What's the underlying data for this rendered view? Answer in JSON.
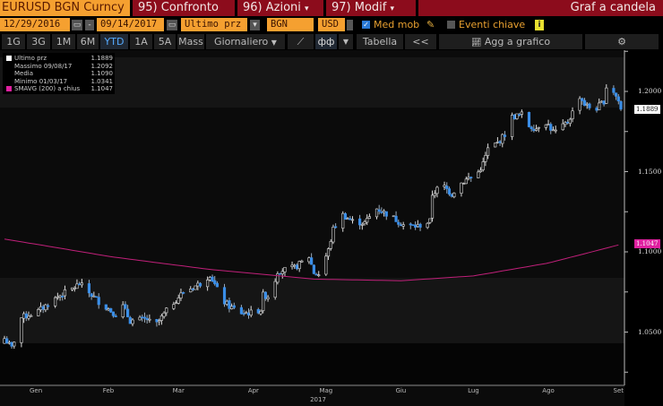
{
  "header": {
    "ticker": "EURUSD BGN Curncy",
    "compare_button": "95) Confronto",
    "actions_button": "96) Azioni",
    "edit_button": "97) Modif",
    "chart_type_title": "Graf a candela"
  },
  "controls": {
    "start_date": "12/29/2016",
    "date_separator": "-",
    "end_date": "09/14/2017",
    "field": "Ultimo prz",
    "source": "BGN",
    "currency": "USD",
    "moving_avg_label": "Med mob",
    "moving_avg_checked": true,
    "events_label": "Eventi chiave",
    "events_checked": false,
    "info_icon": "i"
  },
  "toolbar": {
    "periods": [
      "1G",
      "3G",
      "1M",
      "6M",
      "YTD",
      "1A",
      "5A",
      "Mass"
    ],
    "selected_period": "YTD",
    "frequency": "Giornaliero",
    "table_button": "Tabella",
    "collapse_button": "<<",
    "add_to_chart_button": "Agg a grafico"
  },
  "legend": [
    {
      "label": "Ultimo prz",
      "value": "1.1889",
      "color": "#ffffff"
    },
    {
      "label": "Massimo 09/08/17",
      "value": "1.2092",
      "color": ""
    },
    {
      "label": "Media",
      "value": "1.1090",
      "color": ""
    },
    {
      "label": "Minimo 01/03/17",
      "value": "1.0341",
      "color": ""
    },
    {
      "label": "SMAVG (200) a chius",
      "value": "1.1047",
      "color": "#e020a0"
    }
  ],
  "chart_data": {
    "type": "candlestick",
    "title": "Graf a candela",
    "year_label": "2017",
    "x_ticks": [
      "Gen",
      "Feb",
      "Mar",
      "Apr",
      "Mag",
      "Giu",
      "Lug",
      "Ago",
      "Set"
    ],
    "y_ticks": [
      "1.2000",
      "1.1500",
      "1.1000",
      "1.0500"
    ],
    "y_tick_values": [
      1.2,
      1.15,
      1.1,
      1.05
    ],
    "ylim": [
      1.018,
      1.225
    ],
    "last_price_tag": "1.1889",
    "sma_tag": "1.1047",
    "close_keypoints": [
      [
        "01/02",
        1.046
      ],
      [
        "01/05",
        1.04
      ],
      [
        "01/09",
        1.059
      ],
      [
        "01/16",
        1.063
      ],
      [
        "01/24",
        1.072
      ],
      [
        "01/30",
        1.077
      ],
      [
        "02/02",
        1.08
      ],
      [
        "02/10",
        1.069
      ],
      [
        "02/17",
        1.061
      ],
      [
        "02/20",
        1.066
      ],
      [
        "02/23",
        1.057
      ],
      [
        "03/02",
        1.058
      ],
      [
        "03/05",
        1.053
      ],
      [
        "03/12",
        1.067
      ],
      [
        "03/17",
        1.075
      ],
      [
        "03/25",
        1.081
      ],
      [
        "03/28",
        1.086
      ],
      [
        "04/02",
        1.07
      ],
      [
        "04/05",
        1.066
      ],
      [
        "04/10",
        1.062
      ],
      [
        "04/14",
        1.062
      ],
      [
        "04/18",
        1.064
      ],
      [
        "04/19",
        1.073
      ],
      [
        "04/22",
        1.072
      ],
      [
        "04/25",
        1.088
      ],
      [
        "05/02",
        1.09
      ],
      [
        "05/08",
        1.097
      ],
      [
        "05/10",
        1.087
      ],
      [
        "05/12",
        1.086
      ],
      [
        "05/16",
        1.101
      ],
      [
        "05/18",
        1.114
      ],
      [
        "05/22",
        1.123
      ],
      [
        "05/26",
        1.119
      ],
      [
        "05/31",
        1.118
      ],
      [
        "06/05",
        1.127
      ],
      [
        "06/10",
        1.123
      ],
      [
        "06/12",
        1.121
      ],
      [
        "06/17",
        1.116
      ],
      [
        "06/22",
        1.116
      ],
      [
        "06/27",
        1.119
      ],
      [
        "06/28",
        1.136
      ],
      [
        "07/02",
        1.142
      ],
      [
        "07/06",
        1.136
      ],
      [
        "07/09",
        1.142
      ],
      [
        "07/13",
        1.146
      ],
      [
        "07/16",
        1.147
      ],
      [
        "07/19",
        1.155
      ],
      [
        "07/21",
        1.164
      ],
      [
        "07/25",
        1.168
      ],
      [
        "07/29",
        1.175
      ],
      [
        "07/31",
        1.184
      ],
      [
        "08/05",
        1.186
      ],
      [
        "08/06",
        1.179
      ],
      [
        "08/10",
        1.177
      ],
      [
        "08/13",
        1.183
      ],
      [
        "08/17",
        1.175
      ],
      [
        "08/19",
        1.175
      ],
      [
        "08/23",
        1.181
      ],
      [
        "08/26",
        1.19
      ],
      [
        "08/28",
        1.197
      ],
      [
        "08/30",
        1.192
      ],
      [
        "09/03",
        1.188
      ],
      [
        "09/07",
        1.194
      ],
      [
        "09/08",
        1.203
      ],
      [
        "09/10",
        1.203
      ],
      [
        "09/13",
        1.194
      ],
      [
        "09/14",
        1.1889
      ]
    ],
    "sma200_keypoints": [
      [
        "01/02",
        1.108
      ],
      [
        "02/15",
        1.097
      ],
      [
        "03/28",
        1.089
      ],
      [
        "05/10",
        1.083
      ],
      [
        "06/15",
        1.082
      ],
      [
        "07/15",
        1.085
      ],
      [
        "08/15",
        1.093
      ],
      [
        "09/14",
        1.1047
      ]
    ],
    "colors": {
      "up": "#dddddd",
      "down": "#3a8ee8",
      "sma": "#c0207a",
      "background": "#0b0b0b",
      "band": "#151515"
    }
  }
}
